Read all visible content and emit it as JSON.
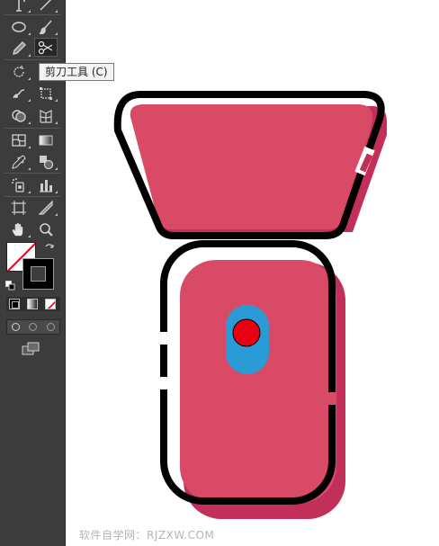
{
  "tooltip": {
    "text": "剪刀工具 (C)"
  },
  "watermark": {
    "text": "软件自学网：RJZXW.COM"
  },
  "colors": {
    "toolbar_bg": "#3c3c3c",
    "shape_fill": "#d94a67",
    "shape_shadow": "#c2305a",
    "outline": "#000000",
    "button_blue": "#2b9bd8",
    "button_red": "#e60012"
  },
  "tools": [
    "type-tool-icon",
    "line-tool-icon",
    "ellipse-tool-icon",
    "paintbrush-tool-icon",
    "pencil-tool-icon",
    "scissors-tool-icon",
    "rotate-tool-icon",
    "scale-tool-icon",
    "warp-tool-icon",
    "free-transform-tool-icon",
    "shape-builder-tool-icon",
    "perspective-grid-tool-icon",
    "mesh-tool-icon",
    "gradient-tool-icon",
    "eyedropper-tool-icon",
    "blend-tool-icon",
    "symbol-sprayer-tool-icon",
    "column-graph-tool-icon",
    "artboard-tool-icon",
    "slice-tool-icon",
    "hand-tool-icon",
    "zoom-tool-icon"
  ],
  "active_tool": "scissors-tool-icon"
}
